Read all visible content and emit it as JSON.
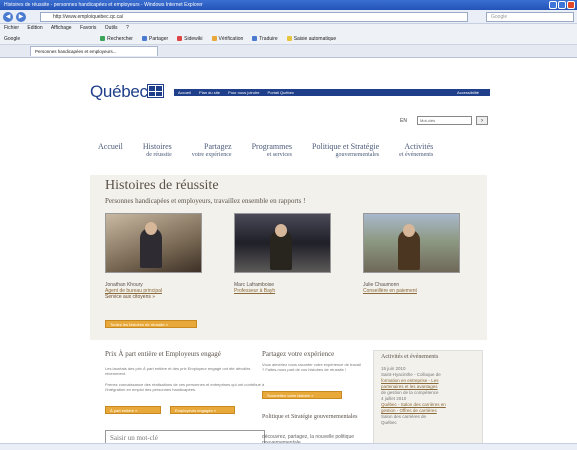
{
  "browser": {
    "title": "Histoires de réussite - personnes handicapées et employeurs - Windows Internet Explorer",
    "url": "http://www.emploiquebec.qc.ca/",
    "search_placeholder": "Google",
    "menu": [
      "Fichier",
      "Edition",
      "Affichage",
      "Favoris",
      "Outils",
      "?"
    ],
    "google_label": "Google",
    "toolbar_items": [
      "Rechercher",
      "Partager",
      "Sidewiki",
      "Vérification",
      "Traduire",
      "Saisie automatique"
    ],
    "tab_label": "Personnes handicapées et employeurs..."
  },
  "site": {
    "logo": "Québec",
    "topnav": [
      "Accueil",
      "Plan du site",
      "Pour nous joindre",
      "Portail Québec"
    ],
    "access": "Accessibilité",
    "lang": "EN",
    "search_placeholder": "Mot-clés"
  },
  "mainnav": [
    {
      "line1": "Accueil",
      "line2": ""
    },
    {
      "line1": "Histoires",
      "line2": "de réussite"
    },
    {
      "line1": "Partagez",
      "line2": "votre expérience"
    },
    {
      "line1": "Programmes",
      "line2": "et services"
    },
    {
      "line1": "Politique et Stratégie",
      "line2": "gouvernementales"
    },
    {
      "line1": "Activités",
      "line2": "et événements"
    }
  ],
  "hero": {
    "title": "Histoires de réussite",
    "subtitle": "Personnes handicapées et employeurs, travaillez ensemble en rapports !",
    "cards": [
      {
        "name": "Jonathan Khoury",
        "link": "Agent de bureau principal",
        "role": "Service aux citoyens »"
      },
      {
        "name": "Marc Laframboise",
        "link": "Professeur à Bayh",
        "role": ""
      },
      {
        "name": "Julie Chaumonn",
        "link": "Conseillère en paiement",
        "role": ""
      }
    ],
    "more_button": "Toutes les histoires de réussite »"
  },
  "col1": {
    "title": "Prix À part entière et Employeurs engagé",
    "text1": "Les lauréats des prix À part entière et des prix Employeur engagé ont été dévoilés récemment.",
    "text2": "Prenez connaissance des réalisations de ces personnes et entreprises qui ont contribué à l'intégration en emploi des personnes handicapées.",
    "btn1": "À part entière »",
    "btn2": "Employeurs engagés »",
    "search_placeholder": "Saisir un mot-clé"
  },
  "col2": {
    "title": "Partagez votre expérience",
    "text": "Vous aimeriez nous raconter votre expérience de travail ? Faites-nous part de vos histoires de réussite !",
    "button": "Soumettez votre histoire »",
    "title2": "Politique et Stratégie gouvernementales",
    "text2": "découvrez, partagez, la nouvelle politique gouvernementale"
  },
  "col3": {
    "title": "Activités et événements",
    "text": [
      "15 juin 2010",
      "Saint-Hyacinthe - Colloque de",
      "formation en entreprise - Les",
      "partenaires et les avantages",
      "de gestion de la compétence",
      "4 juillet 2010",
      "Québec - Salon des carrières en",
      "gestion - Offres de carrières",
      "Salon des carrières de",
      "Québec"
    ]
  }
}
